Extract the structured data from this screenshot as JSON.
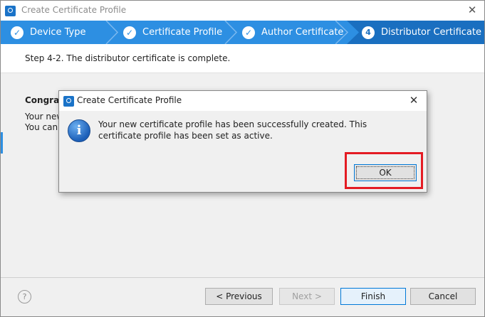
{
  "window": {
    "title": "Create Certificate Profile",
    "close_glyph": "✕"
  },
  "steps": [
    {
      "label": "Device Type",
      "state": "done",
      "marker": "✓"
    },
    {
      "label": "Certificate Profile",
      "state": "done",
      "marker": "✓"
    },
    {
      "label": "Author Certificate",
      "state": "done",
      "marker": "✓"
    },
    {
      "label": "Distributor Certificate",
      "state": "active",
      "marker": "4"
    }
  ],
  "step_message": "Step 4-2. The distributor certificate is complete.",
  "content": {
    "congrats_partial": "Congrat",
    "line1_partial": "Your new",
    "line2_partial": "You can"
  },
  "footer": {
    "help_glyph": "?",
    "previous": "< Previous",
    "next": "Next >",
    "finish": "Finish",
    "cancel": "Cancel"
  },
  "dialog": {
    "title": "Create Certificate Profile",
    "close_glyph": "✕",
    "icon_glyph": "i",
    "message": "Your new certificate profile has been successfully created. This certificate profile has been set as active.",
    "ok": "OK"
  },
  "colors": {
    "steps_bar": "#2d8fe2",
    "active_step": "#1a6fc0",
    "highlight": "#e41b23"
  }
}
